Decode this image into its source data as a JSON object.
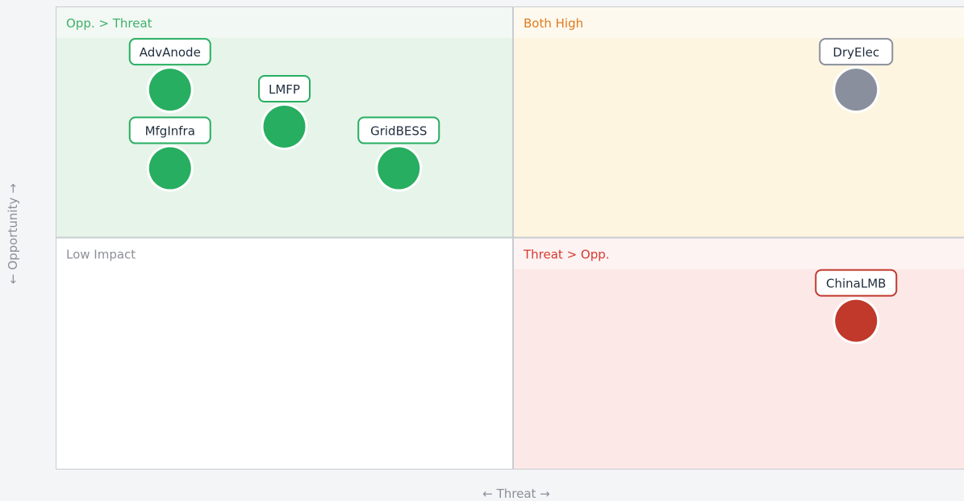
{
  "chart_data": {
    "type": "scatter",
    "subtype": "quadrant",
    "xlabel": "← Threat →",
    "ylabel": "← Opportunity →",
    "xlim": [
      0,
      100
    ],
    "ylim": [
      0,
      100
    ],
    "grid": false,
    "quadrants": [
      {
        "key": "tl",
        "label": "Opp. > Threat",
        "label_color": "#3fb06a",
        "fill": "#e6f4ea",
        "header_fill": "#f2f8f3"
      },
      {
        "key": "tr",
        "label": "Both High",
        "label_color": "#e07a20",
        "fill": "#fdf5df",
        "header_fill": "#fef9ee"
      },
      {
        "key": "bl",
        "label": "Low Impact",
        "label_color": "#8c9096",
        "fill": "#ffffff",
        "header_fill": "#ffffff"
      },
      {
        "key": "br",
        "label": "Threat > Opp.",
        "label_color": "#d63a2f",
        "fill": "#fde8e8",
        "header_fill": "#fdf3f3"
      }
    ],
    "points": [
      {
        "label": "AdvAnode",
        "x": 12.5,
        "y": 82,
        "color": "#27ae60",
        "border": "#27ae60"
      },
      {
        "label": "LMFP",
        "x": 25,
        "y": 74,
        "color": "#27ae60",
        "border": "#27ae60"
      },
      {
        "label": "MfgInfra",
        "x": 12.5,
        "y": 65,
        "color": "#27ae60",
        "border": "#27ae60"
      },
      {
        "label": "GridBESS",
        "x": 37.5,
        "y": 65,
        "color": "#27ae60",
        "border": "#27ae60"
      },
      {
        "label": "DryElec",
        "x": 87.5,
        "y": 82,
        "color": "#8a8f9e",
        "border": "#8a8f9e"
      },
      {
        "label": "ChinaLMB",
        "x": 87.5,
        "y": 32,
        "color": "#c0392b",
        "border": "#c0392b"
      }
    ]
  }
}
